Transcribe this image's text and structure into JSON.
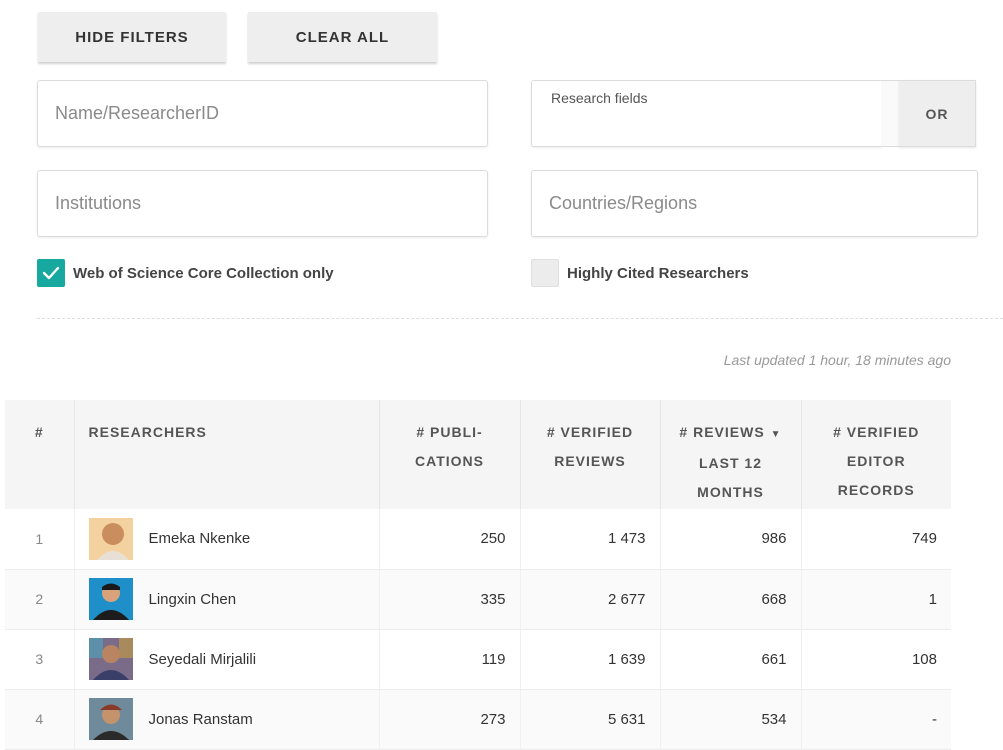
{
  "filters": {
    "hide_label": "HIDE FILTERS",
    "clear_label": "CLEAR ALL",
    "name_placeholder": "Name/ResearcherID",
    "research_fields_label": "Research fields",
    "or_label": "OR",
    "institutions_placeholder": "Institutions",
    "countries_placeholder": "Countries/Regions",
    "wos_checkbox": {
      "label": "Web of Science Core Collection only",
      "checked": true
    },
    "hcr_checkbox": {
      "label": "Highly Cited Researchers",
      "checked": false
    }
  },
  "last_updated": "Last updated 1 hour, 18 minutes ago",
  "table": {
    "headers": {
      "index": "#",
      "researchers": "RESEARCHERS",
      "publications": [
        "# PUBLI-",
        "CATIONS"
      ],
      "verified_reviews": [
        "# VERIFIED",
        "REVIEWS"
      ],
      "reviews_12m": [
        "# REVIEWS",
        "LAST 12",
        "MONTHS"
      ],
      "editor_records": [
        "# VERIFIED",
        "EDITOR",
        "RECORDS"
      ],
      "sort_indicator": "▼"
    },
    "rows": [
      {
        "index": "1",
        "name": "Emeka Nkenke",
        "publications": "250",
        "verified_reviews": "1 473",
        "reviews_12m": "986",
        "editor_records": "749",
        "avatar": "avatar-emeka"
      },
      {
        "index": "2",
        "name": "Lingxin Chen",
        "publications": "335",
        "verified_reviews": "2 677",
        "reviews_12m": "668",
        "editor_records": "1",
        "avatar": "avatar-lingxin"
      },
      {
        "index": "3",
        "name": "Seyedali Mirjalili",
        "publications": "119",
        "verified_reviews": "1 639",
        "reviews_12m": "661",
        "editor_records": "108",
        "avatar": "avatar-seyedali"
      },
      {
        "index": "4",
        "name": "Jonas Ranstam",
        "publications": "273",
        "verified_reviews": "5 631",
        "reviews_12m": "534",
        "editor_records": "-",
        "avatar": "avatar-jonas"
      }
    ]
  },
  "colors": {
    "accent": "#17a8a0",
    "button_bg": "#eeeeee",
    "header_bg": "#f5f5f5"
  }
}
